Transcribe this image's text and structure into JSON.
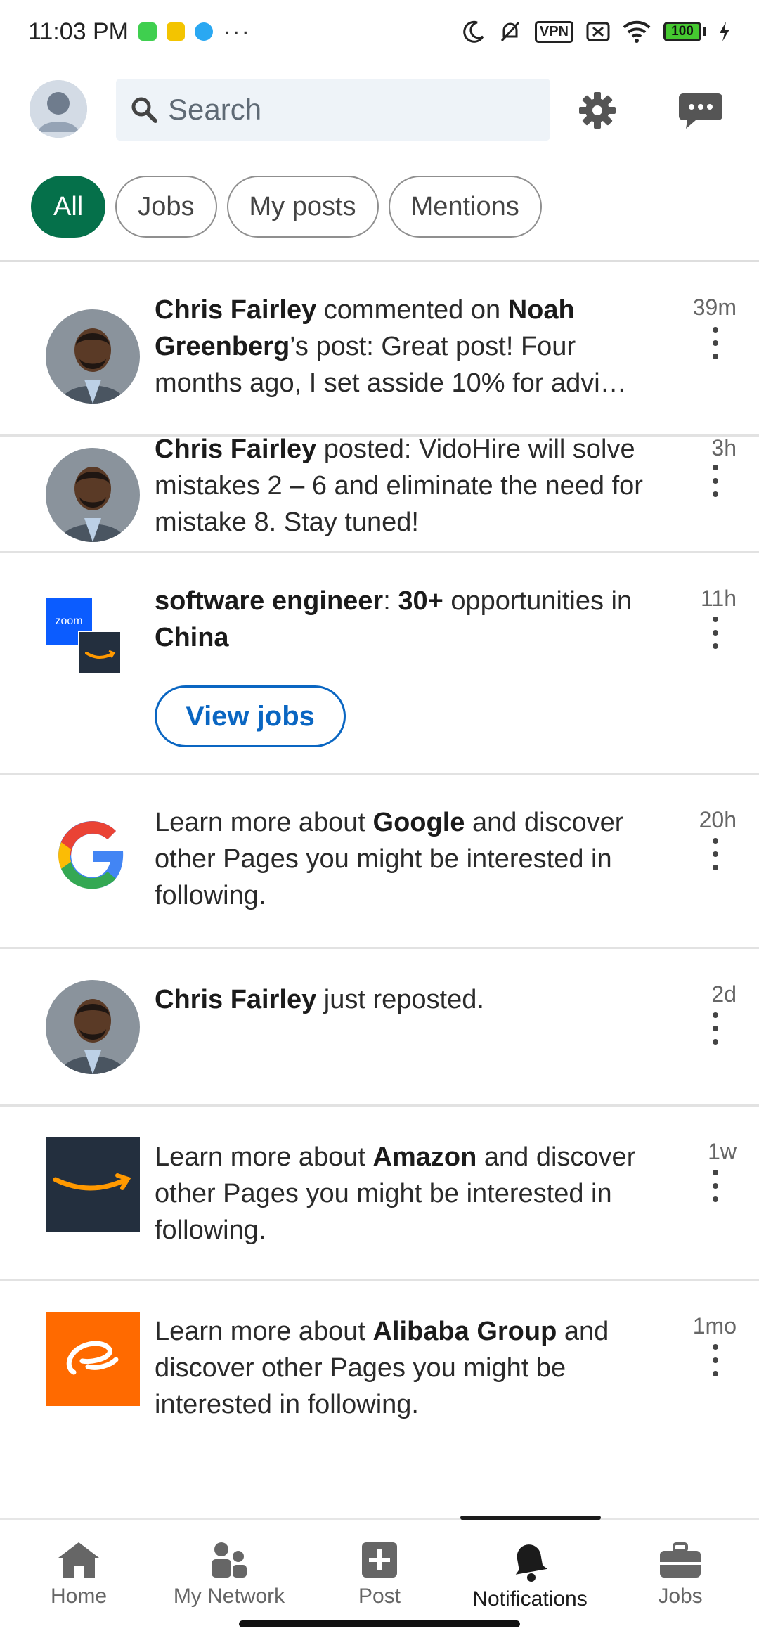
{
  "status_bar": {
    "time": "11:03 PM",
    "dots": "···",
    "vpn": "VPN",
    "battery": "100"
  },
  "header": {
    "search_placeholder": "Search",
    "icons": [
      "settings-icon",
      "messaging-icon"
    ]
  },
  "filters": [
    {
      "label": "All",
      "active": true
    },
    {
      "label": "Jobs",
      "active": false
    },
    {
      "label": "My posts",
      "active": false
    },
    {
      "label": "Mentions",
      "active": false
    }
  ],
  "notifications": [
    {
      "parts": [
        {
          "t": "Chris Fairley",
          "b": true
        },
        {
          "t": " commented on ",
          "b": false
        },
        {
          "t": "Noah Greenberg",
          "b": true
        },
        {
          "t": "’s post: Great post! Four months ago, I set asside 10% for advi…",
          "b": false
        }
      ],
      "time": "39m",
      "thumb": "person-avatar"
    },
    {
      "parts": [
        {
          "t": "Chris Fairley",
          "b": true
        },
        {
          "t": " posted: VidoHire will solve mistakes 2 – 6 and eliminate the need for mistake 8. Stay tuned!",
          "b": false
        }
      ],
      "time": "3h",
      "thumb": "person-avatar"
    },
    {
      "parts": [
        {
          "t": "software engineer",
          "b": true
        },
        {
          "t": ": ",
          "b": false
        },
        {
          "t": "30+",
          "b": true
        },
        {
          "t": " opportunities in ",
          "b": false
        },
        {
          "t": "China",
          "b": true
        }
      ],
      "time": "11h",
      "thumb": "zoom-amazon-logos",
      "action": "View jobs"
    },
    {
      "parts": [
        {
          "t": "Learn more about ",
          "b": false
        },
        {
          "t": "Google",
          "b": true
        },
        {
          "t": " and discover other Pages you might be interested in following.",
          "b": false
        }
      ],
      "time": "20h",
      "thumb": "google-logo"
    },
    {
      "parts": [
        {
          "t": "Chris Fairley",
          "b": true
        },
        {
          "t": " just reposted.",
          "b": false
        }
      ],
      "time": "2d",
      "thumb": "person-avatar"
    },
    {
      "parts": [
        {
          "t": "Learn more about ",
          "b": false
        },
        {
          "t": "Amazon",
          "b": true
        },
        {
          "t": " and discover other Pages you might be interested in following.",
          "b": false
        }
      ],
      "time": "1w",
      "thumb": "amazon-logo"
    },
    {
      "parts": [
        {
          "t": "Learn more about ",
          "b": false
        },
        {
          "t": "Alibaba Group",
          "b": true
        },
        {
          "t": " and discover other Pages you might be interested in following.",
          "b": false
        }
      ],
      "time": "1mo",
      "thumb": "alibaba-logo"
    }
  ],
  "logo_text": {
    "zoom": "zoom"
  },
  "nav": [
    {
      "label": "Home",
      "icon": "home-icon",
      "active": false
    },
    {
      "label": "My Network",
      "icon": "network-icon",
      "active": false
    },
    {
      "label": "Post",
      "icon": "post-icon",
      "active": false
    },
    {
      "label": "Notifications",
      "icon": "bell-icon",
      "active": true
    },
    {
      "label": "Jobs",
      "icon": "briefcase-icon",
      "active": false
    }
  ],
  "colors": {
    "accent_green": "#05704a",
    "link_blue": "#0a66c2",
    "alibaba_orange": "#ff6a00",
    "amazon_navy": "#232f3e",
    "nav_grey": "#666666"
  }
}
